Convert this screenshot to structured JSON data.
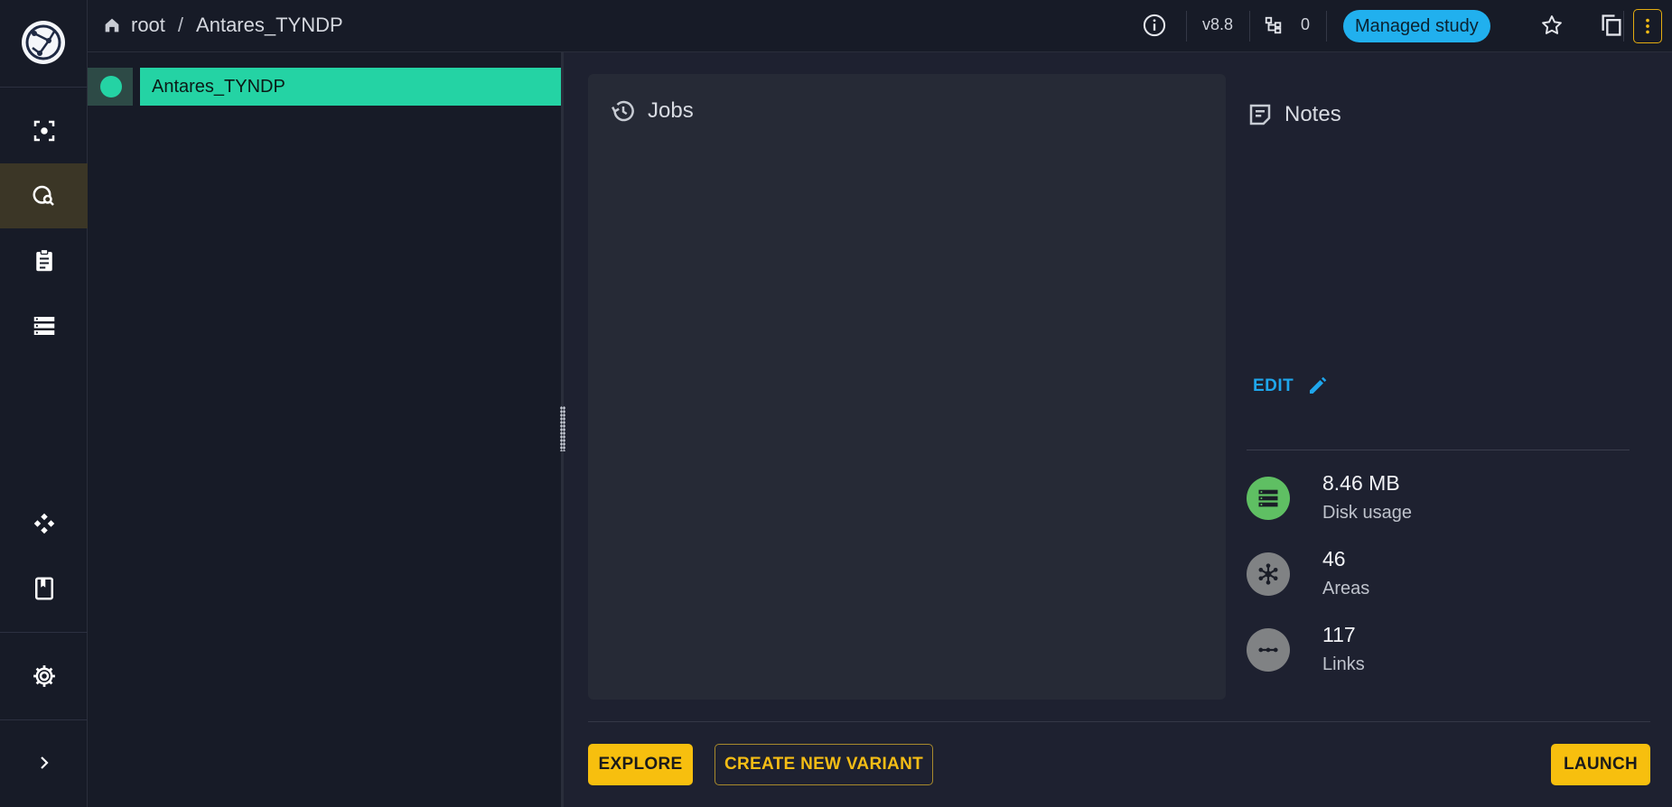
{
  "breadcrumb": {
    "root": "root",
    "separator": "/",
    "current": "Antares_TYNDP"
  },
  "toolbar": {
    "version": "v8.8",
    "variant_count": "0",
    "status_badge": "Managed study"
  },
  "tree": {
    "node_label": "Antares_TYNDP"
  },
  "jobs": {
    "title": "Jobs"
  },
  "notes": {
    "title": "Notes",
    "edit_label": "EDIT"
  },
  "stats": [
    {
      "value": "8.46 MB",
      "label": "Disk usage",
      "icon": "storage-icon",
      "color": "#5fbf63"
    },
    {
      "value": "46",
      "label": "Areas",
      "icon": "hub-icon",
      "color": "#808284"
    },
    {
      "value": "117",
      "label": "Links",
      "icon": "link-icon",
      "color": "#808284"
    }
  ],
  "actions": {
    "explore": "EXPLORE",
    "create_variant": "CREATE NEW VARIANT",
    "launch": "LAUNCH"
  },
  "colors": {
    "accent": "#f7bf0e",
    "tree_selected": "#24d3a4",
    "badge": "#21b0ee",
    "link": "#1fa6ec"
  }
}
